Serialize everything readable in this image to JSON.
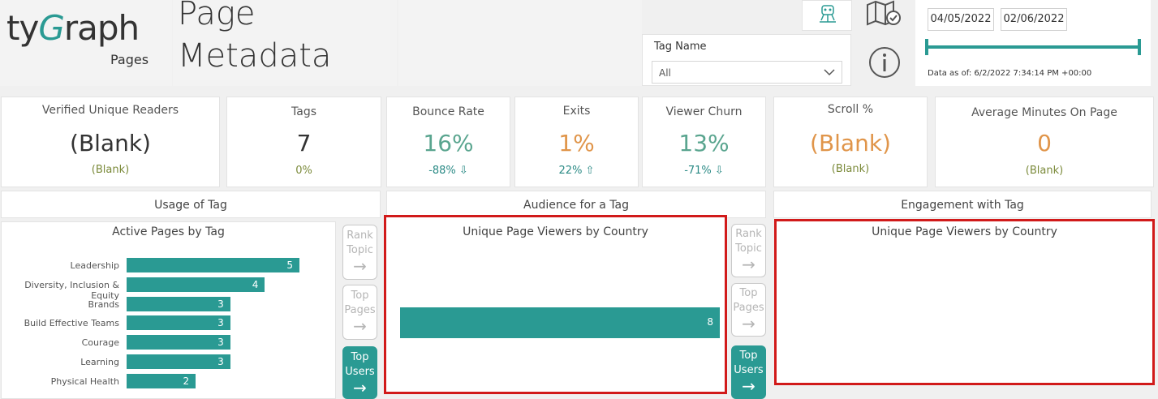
{
  "header": {
    "logo_ty": "ty",
    "logo_g": "G",
    "logo_raph": "raph",
    "logo_sub": "Pages",
    "title_line1": "Page",
    "title_line2": "Metadata"
  },
  "filters": {
    "tag_label": "Tag Name",
    "tag_value": "All",
    "date_start": "04/05/2022",
    "date_end": "02/06/2022",
    "data_as_of": "Data as of: 6/2/2022 7:34:14 PM +00:00"
  },
  "kpis": [
    {
      "label": "Verified Unique Readers",
      "value": "(Blank)",
      "sub": "(Blank)",
      "value_color": "#333333",
      "sub_color": "#7b8a3a"
    },
    {
      "label": "Tags",
      "value": "7",
      "sub": "0%",
      "value_color": "#333333",
      "sub_color": "#7b8a3a"
    },
    {
      "label": "Bounce Rate",
      "value": "16%",
      "sub": "-88% ⇩",
      "value_color": "#5aa58f",
      "sub_color": "#2a8a85"
    },
    {
      "label": "Exits",
      "value": "1%",
      "sub": "22% ⇧",
      "value_color": "#e0954a",
      "sub_color": "#2a8a85"
    },
    {
      "label": "Viewer Churn",
      "value": "13%",
      "sub": "-71% ⇩",
      "value_color": "#5aa58f",
      "sub_color": "#2a8a85"
    },
    {
      "label": "Scroll %",
      "value": "(Blank)",
      "sub": "(Blank)",
      "value_color": "#e0954a",
      "sub_color": "#7b8a3a"
    },
    {
      "label": "Average Minutes On Page",
      "value": "0",
      "sub": "(Blank)",
      "value_color": "#e0954a",
      "sub_color": "#7b8a3a"
    }
  ],
  "sections": {
    "usage": "Usage of Tag",
    "audience": "Audience for a Tag",
    "engagement": "Engagement with Tag"
  },
  "nav": {
    "rank_topic": "Rank Topic",
    "top_pages": "Top Pages",
    "top_users": "Top Users",
    "arrow": "→"
  },
  "chart_data": [
    {
      "type": "bar",
      "title": "Active Pages by Tag",
      "categories": [
        "Leadership",
        "Diversity, Inclusion & Equity",
        "Brands",
        "Build Effective Teams",
        "Courage",
        "Learning",
        "Physical Health"
      ],
      "values": [
        5,
        4,
        3,
        3,
        3,
        3,
        2
      ],
      "color": "#2a9a93"
    },
    {
      "type": "bar",
      "title": "Unique Page Viewers by Country",
      "categories": [
        ""
      ],
      "values": [
        8
      ],
      "color": "#2a9a93"
    },
    {
      "type": "bar",
      "title": "Unique Page Viewers by Country",
      "categories": [],
      "values": []
    }
  ],
  "colors": {
    "accent": "#2a9a93",
    "highlight_border": "#d11a1a"
  },
  "icons": [
    "robot-icon",
    "map-check-icon",
    "info-icon",
    "chevron-down-icon"
  ]
}
